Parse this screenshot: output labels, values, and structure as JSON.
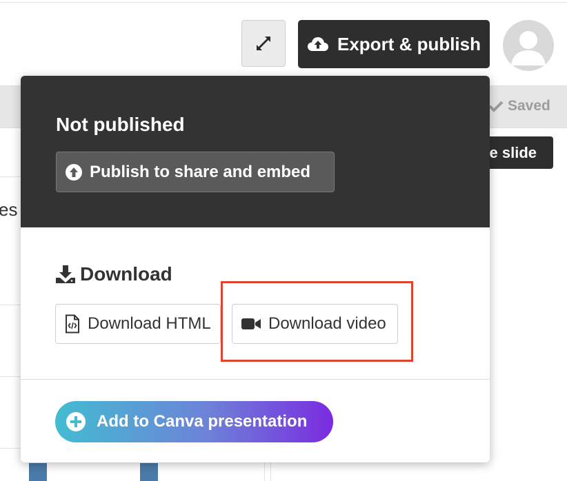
{
  "header": {
    "expand_icon": "expand-arrows-icon",
    "export_button": {
      "label": "Export & publish",
      "icon": "cloud-upload-icon"
    },
    "avatar_icon": "user-avatar-icon"
  },
  "toolbar": {
    "saved_status": "Saved",
    "saved_icon": "check-icon",
    "slide_button_label": "e slide"
  },
  "background": {
    "peek_text": "es"
  },
  "popup": {
    "publish_status": "Not published",
    "publish_button": {
      "label": "Publish to share and embed",
      "icon": "arrow-up-circle-icon"
    },
    "download": {
      "heading": "Download",
      "icon": "download-icon",
      "buttons": [
        {
          "label": "Download HTML",
          "icon": "file-code-icon"
        },
        {
          "label": "Download video",
          "icon": "video-camera-icon"
        }
      ]
    },
    "canva_button": {
      "label": "Add to Canva presentation",
      "icon": "plus-circle-icon"
    }
  },
  "colors": {
    "dark": "#333333",
    "highlight": "#e0442c",
    "canva_gradient_start": "#43bcd1",
    "canva_gradient_end": "#7b2be0"
  }
}
